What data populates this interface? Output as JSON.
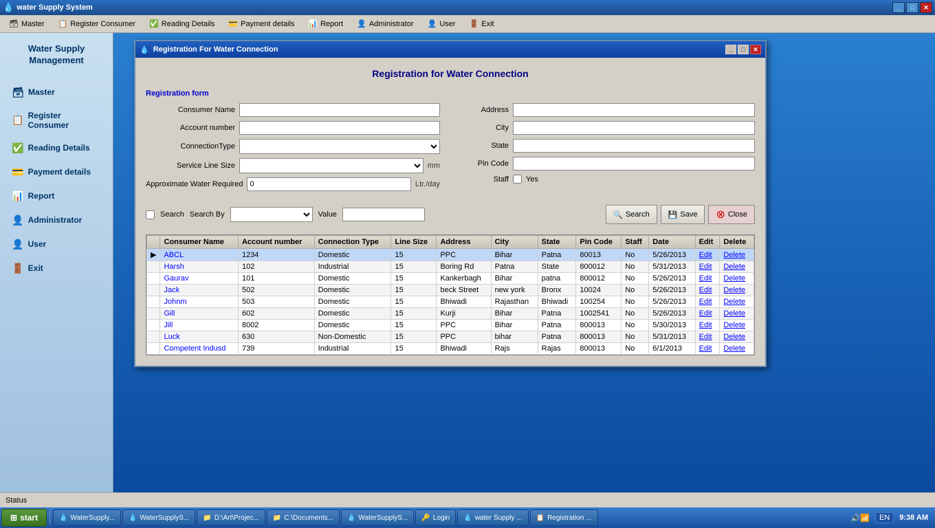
{
  "app": {
    "title": "water Supply System",
    "icon": "💧"
  },
  "titlebar": {
    "controls": [
      "_",
      "□",
      "✕"
    ]
  },
  "menubar": {
    "items": [
      {
        "label": "Master",
        "icon": "🗃"
      },
      {
        "label": "Register Consumer",
        "icon": "📋"
      },
      {
        "label": "Reading Details",
        "icon": "✅"
      },
      {
        "label": "Payment details",
        "icon": "💳"
      },
      {
        "label": "Report",
        "icon": "📊"
      },
      {
        "label": "Administrator",
        "icon": "👤"
      },
      {
        "label": "User",
        "icon": "👤"
      },
      {
        "label": "Exit",
        "icon": "🚪"
      }
    ]
  },
  "sidebar": {
    "title": "Water Supply Management",
    "items": [
      {
        "label": "Master",
        "icon": "🗃"
      },
      {
        "label": "Register Consumer",
        "icon": "📋"
      },
      {
        "label": "Reading Details",
        "icon": "✅"
      },
      {
        "label": "Payment details",
        "icon": "💳"
      },
      {
        "label": "Report",
        "icon": "📊"
      },
      {
        "label": "Administrator",
        "icon": "👤"
      },
      {
        "label": "User",
        "icon": "👤"
      },
      {
        "label": "Exit",
        "icon": "🚪"
      }
    ]
  },
  "modal": {
    "title": "Registration For Water Connection",
    "icon": "💧",
    "form_title": "Registration for Water Connection",
    "section_label": "Registration form",
    "fields": {
      "consumer_name": {
        "label": "Consumer Name",
        "value": "",
        "placeholder": ""
      },
      "account_number": {
        "label": "Account number",
        "value": "",
        "placeholder": ""
      },
      "connection_type": {
        "label": "ConnectionType",
        "value": ""
      },
      "service_line_size": {
        "label": "Service Line Size",
        "value": ""
      },
      "approx_water": {
        "label": "Approximate Water Required",
        "value": "0",
        "unit": "Ltr./day"
      },
      "address": {
        "label": "Address",
        "value": ""
      },
      "city": {
        "label": "City",
        "value": ""
      },
      "state": {
        "label": "State",
        "value": ""
      },
      "pin_code": {
        "label": "Pin Code",
        "value": ""
      },
      "staff": {
        "label": "Staff",
        "value": ""
      },
      "staff_yes": "Yes",
      "mm_unit": "mm"
    },
    "search_bar": {
      "search_checkbox_label": "Search",
      "search_by_label": "Search By",
      "value_label": "Value",
      "search_btn": "Search",
      "save_btn": "Save",
      "close_btn": "Close"
    },
    "table": {
      "columns": [
        "",
        "Consumer Name",
        "Account number",
        "Connection Type",
        "Line Size",
        "Address",
        "City",
        "State",
        "Pin Code",
        "Staff",
        "Date",
        "Edit",
        "Delete"
      ],
      "rows": [
        {
          "selected": true,
          "consumer_name": "ABCL",
          "account": "1234",
          "conn_type": "Domestic",
          "line_size": "15",
          "address": "PPC",
          "city": "Bihar",
          "state": "Patna",
          "pin": "80013",
          "staff": "No",
          "date": "5/26/2013",
          "edit": "Edit",
          "delete": "Delete"
        },
        {
          "selected": false,
          "consumer_name": "Harsh",
          "account": "102",
          "conn_type": "Industrial",
          "line_size": "15",
          "address": "Boring Rd",
          "city": "Patna",
          "state": "State",
          "pin": "800012",
          "staff": "No",
          "date": "5/31/2013",
          "edit": "Edit",
          "delete": "Delete"
        },
        {
          "selected": false,
          "consumer_name": "Gaurav",
          "account": "101",
          "conn_type": "Domestic",
          "line_size": "15",
          "address": "Kankerbagh",
          "city": "Bihar",
          "state": "patna",
          "pin": "800012",
          "staff": "No",
          "date": "5/26/2013",
          "edit": "Edit",
          "delete": "Delete"
        },
        {
          "selected": false,
          "consumer_name": "Jack",
          "account": "502",
          "conn_type": "Domestic",
          "line_size": "15",
          "address": "beck Street",
          "city": "new york",
          "state": "Bronx",
          "pin": "10024",
          "staff": "No",
          "date": "5/26/2013",
          "edit": "Edit",
          "delete": "Delete"
        },
        {
          "selected": false,
          "consumer_name": "Johnm",
          "account": "503",
          "conn_type": "Domestic",
          "line_size": "15",
          "address": "Bhiwadi",
          "city": "Rajasthan",
          "state": "Bhiwadi",
          "pin": "100254",
          "staff": "No",
          "date": "5/26/2013",
          "edit": "Edit",
          "delete": "Delete"
        },
        {
          "selected": false,
          "consumer_name": "Gill",
          "account": "602",
          "conn_type": "Domestic",
          "line_size": "15",
          "address": "Kurji",
          "city": "Bihar",
          "state": "Patna",
          "pin": "1002541",
          "staff": "No",
          "date": "5/26/2013",
          "edit": "Edit",
          "delete": "Delete"
        },
        {
          "selected": false,
          "consumer_name": "Jill",
          "account": "8002",
          "conn_type": "Domestic",
          "line_size": "15",
          "address": "PPC",
          "city": "Bihar",
          "state": "Patna",
          "pin": "800013",
          "staff": "No",
          "date": "5/30/2013",
          "edit": "Edit",
          "delete": "Delete"
        },
        {
          "selected": false,
          "consumer_name": "Luck",
          "account": "630",
          "conn_type": "Non-Domestic",
          "line_size": "15",
          "address": "PPC",
          "city": "bihar",
          "state": "Patna",
          "pin": "800013",
          "staff": "No",
          "date": "5/31/2013",
          "edit": "Edit",
          "delete": "Delete"
        },
        {
          "selected": false,
          "consumer_name": "Competent Indusd",
          "account": "739",
          "conn_type": "Industrial",
          "line_size": "15",
          "address": "Bhiwadi",
          "city": "Rajs",
          "state": "Rajas",
          "pin": "800013",
          "staff": "No",
          "date": "6/1/2013",
          "edit": "Edit",
          "delete": "Delete"
        }
      ]
    }
  },
  "status_bar": {
    "text": "Status"
  },
  "taskbar": {
    "start_label": "start",
    "items": [
      {
        "label": "WaterSupply...",
        "icon": "💧"
      },
      {
        "label": "WaterSupplyS...",
        "icon": "💧"
      },
      {
        "label": "D:\\Art\\Projec...",
        "icon": "📁"
      },
      {
        "label": "C:\\Documents...",
        "icon": "📁"
      },
      {
        "label": "WaterSupplyS...",
        "icon": "💧"
      },
      {
        "label": "Login",
        "icon": "🔑"
      },
      {
        "label": "water Supply ...",
        "icon": "💧"
      },
      {
        "label": "Registration ...",
        "icon": "📋"
      }
    ],
    "lang": "EN",
    "time": "9:38 AM"
  }
}
